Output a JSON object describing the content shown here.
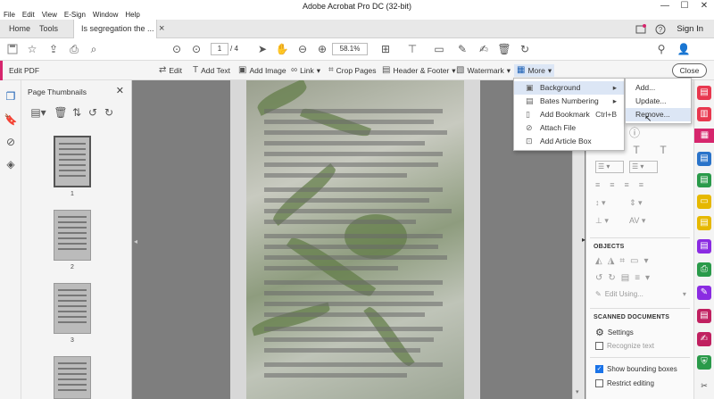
{
  "titlebar": {
    "menus": [
      "File",
      "Edit",
      "View",
      "E-Sign",
      "Window",
      "Help"
    ],
    "title": "Adobe Acrobat Pro DC (32-bit)",
    "window_buttons": [
      "—",
      "☐",
      "✕"
    ]
  },
  "tabs": {
    "home": "Home",
    "tools": "Tools",
    "document": "Is segregation the ...",
    "close": "×"
  },
  "header": {
    "sign_in": "Sign In"
  },
  "toolbar": {
    "page_current": "1",
    "page_total": "/ 4",
    "zoom": "58.1%"
  },
  "edit_bar": {
    "title": "Edit PDF",
    "edit": "Edit",
    "add_text": "Add Text",
    "add_image": "Add Image",
    "link": "Link",
    "crop_pages": "Crop Pages",
    "header_footer": "Header & Footer",
    "watermark": "Watermark",
    "more": "More",
    "close": "Close"
  },
  "thumbnails": {
    "title": "Page Thumbnails",
    "pages": [
      "1",
      "2",
      "3"
    ]
  },
  "more_menu": {
    "items": [
      {
        "label": "Background",
        "arrow": "▸"
      },
      {
        "label": "Bates Numbering",
        "arrow": "▸"
      },
      {
        "label": "Add Bookmark",
        "shortcut": "Ctrl+B"
      },
      {
        "label": "Attach File"
      },
      {
        "label": "Add Article Box"
      }
    ]
  },
  "background_submenu": {
    "items": [
      "Add...",
      "Update...",
      "Remove..."
    ]
  },
  "right_panel": {
    "objects_heading": "OBJECTS",
    "edit_using": "Edit Using...",
    "scanned_heading": "SCANNED DOCUMENTS",
    "settings": "Settings",
    "recognize_text": "Recognize text",
    "show_bounding_boxes": "Show bounding boxes",
    "restrict_editing": "Restrict editing"
  },
  "colors": {
    "accent_pink": "#d6266d",
    "highlight": "#dce6f5",
    "viewer_bg": "#7e7e7e"
  }
}
